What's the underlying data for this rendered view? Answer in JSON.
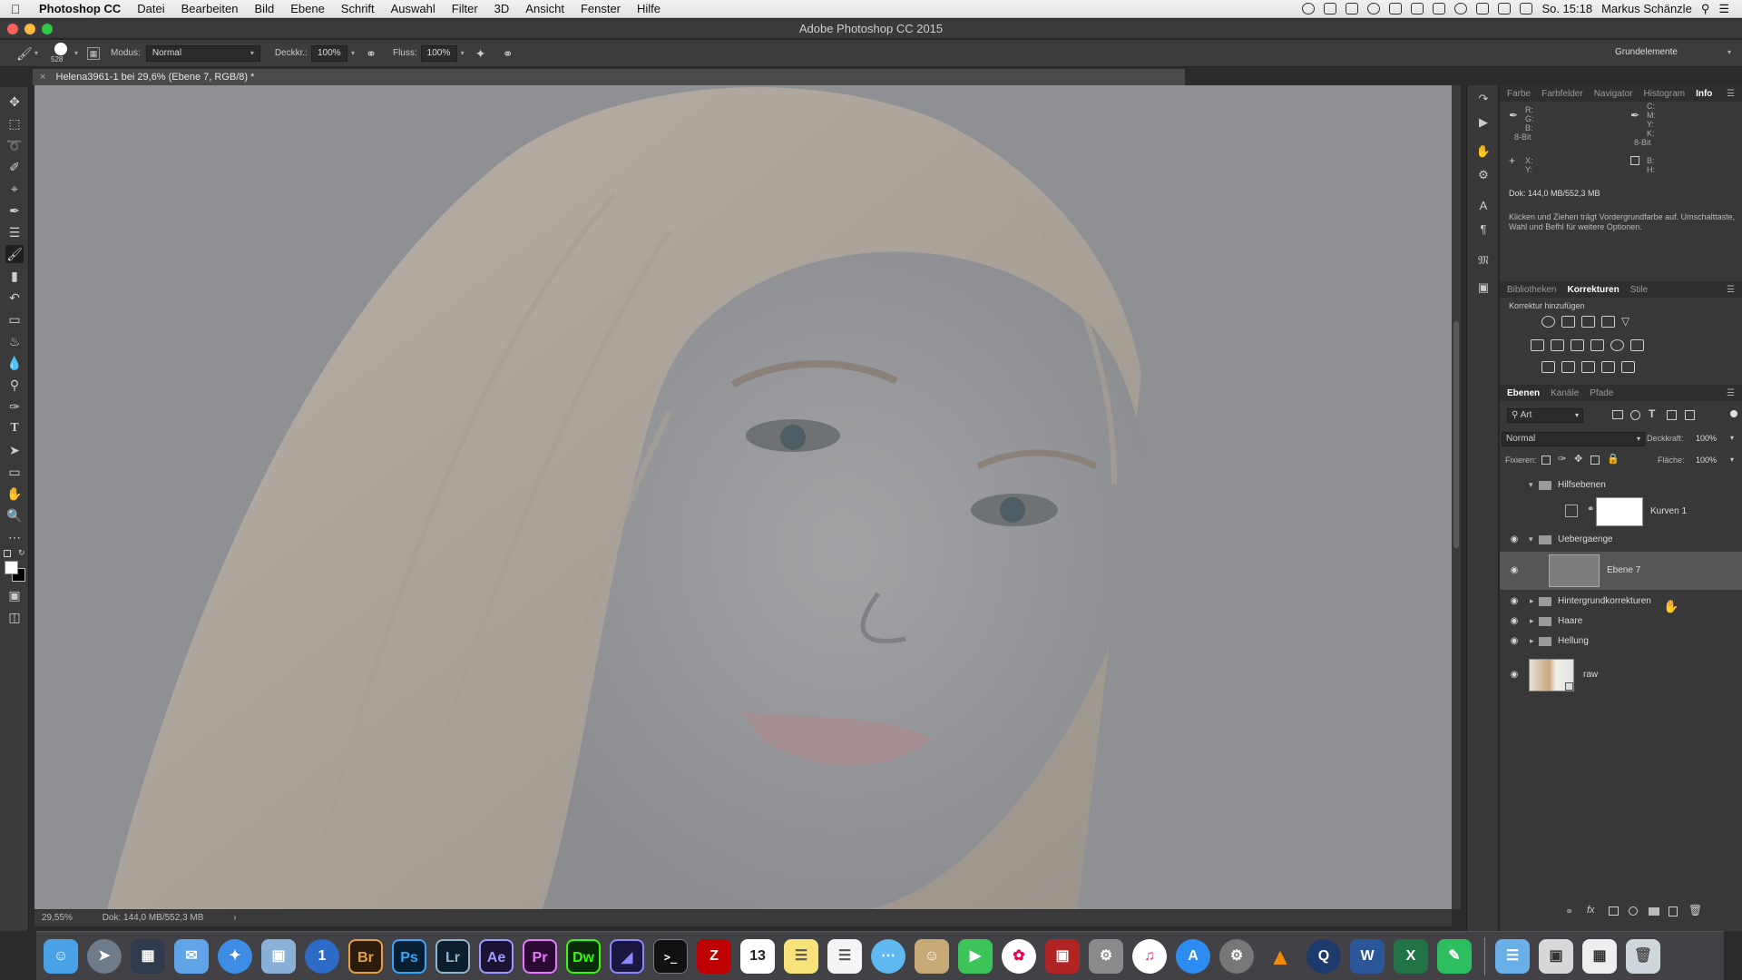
{
  "menubar": {
    "apple_icon": "apple-logo-icon",
    "app_name": "Photoshop CC",
    "menus": [
      "Datei",
      "Bearbeiten",
      "Bild",
      "Ebene",
      "Schrift",
      "Auswahl",
      "Filter",
      "3D",
      "Ansicht",
      "Fenster",
      "Hilfe"
    ],
    "clock": "So. 15:18",
    "user": "Markus Schänzle"
  },
  "window": {
    "title": "Adobe Photoshop CC 2015"
  },
  "options_bar": {
    "brush_size": "528",
    "mode_label": "Modus:",
    "mode_value": "Normal",
    "opacity_label": "Deckkr.:",
    "opacity_value": "100%",
    "flow_label": "Fluss:",
    "flow_value": "100%",
    "workspace": "Grundelemente"
  },
  "document": {
    "tab_title": "Helena3961-1 bei 29,6% (Ebene 7, RGB/8) *",
    "zoom": "29,55%",
    "doc_size": "Dok: 144,0 MB/552,3 MB"
  },
  "info_panel": {
    "tabs": [
      "Farbe",
      "Farbfelder",
      "Navigator",
      "Histogram",
      "Info"
    ],
    "active_tab": "Info",
    "rgb_labels": [
      "R:",
      "G:",
      "B:"
    ],
    "cmyk_labels": [
      "C:",
      "M:",
      "Y:",
      "K:"
    ],
    "bit_left": "8-Bit",
    "bit_right": "8-Bit",
    "xy_labels": [
      "X:",
      "Y:"
    ],
    "bh_labels": [
      "B:",
      "H:"
    ],
    "doc_size": "Dok: 144,0 MB/552,3 MB",
    "hint": "Klicken und Ziehen trägt Vordergrundfarbe auf. Umschalttaste, Wahl und Befhl für weitere Optionen."
  },
  "adjustments_panel": {
    "tabs": [
      "Bibliotheken",
      "Korrekturen",
      "Stile"
    ],
    "active_tab": "Korrekturen",
    "subtitle": "Korrektur hinzufügen"
  },
  "layers_panel": {
    "tabs": [
      "Ebenen",
      "Kanäle",
      "Pfade"
    ],
    "active_tab": "Ebenen",
    "filter_label": "Art",
    "blend_mode": "Normal",
    "opacity_label": "Deckkraft:",
    "opacity_value": "100%",
    "lock_label": "Fixieren:",
    "fill_label": "Fläche:",
    "fill_value": "100%",
    "layers": [
      {
        "name": "Hilfsebenen",
        "type": "group",
        "expanded": true,
        "indent": 0,
        "visible": false
      },
      {
        "name": "Kurven 1",
        "type": "adjustment",
        "indent": 1,
        "visible": false
      },
      {
        "name": "Uebergaenge",
        "type": "group",
        "expanded": true,
        "indent": 0,
        "visible": true
      },
      {
        "name": "Ebene 7",
        "type": "pixel",
        "indent": 1,
        "visible": true,
        "selected": true
      },
      {
        "name": "Hintergrundkorrekturen",
        "type": "group",
        "expanded": false,
        "indent": 0,
        "visible": true
      },
      {
        "name": "Haare",
        "type": "group",
        "expanded": false,
        "indent": 0,
        "visible": true
      },
      {
        "name": "Hellung",
        "type": "group",
        "expanded": false,
        "indent": 0,
        "visible": true
      },
      {
        "name": "raw",
        "type": "smart-object",
        "indent": 0,
        "visible": true
      }
    ]
  },
  "dock": {
    "apps": [
      "Finder",
      "Launchpad",
      "Mission Control",
      "Mail",
      "Safari",
      "Vorschau",
      "1Password",
      "Br",
      "Ps",
      "Lr",
      "Ae",
      "Pr",
      "Dw",
      "Media Encoder",
      "Terminal",
      "FileZilla",
      "Kalender",
      "Notizen",
      "Erinnerungen",
      "Nachrichten",
      "Kontakte",
      "FaceTime",
      "Fotos",
      "Photo Booth",
      "Automator",
      "iTunes",
      "App Store",
      "Systemeinstellungen",
      "VLC",
      "Quicktime",
      "Word",
      "Excel",
      "Evernote",
      "Programme",
      "Downloads",
      "Papierkorb"
    ],
    "calendar_day": "13"
  },
  "colors": {
    "ps_blue": "#31a8ff",
    "br_orange": "#e8a13a",
    "ae_purple": "#9999ff",
    "pr_purple": "#ea77ff",
    "dw_green": "#35fa00"
  }
}
